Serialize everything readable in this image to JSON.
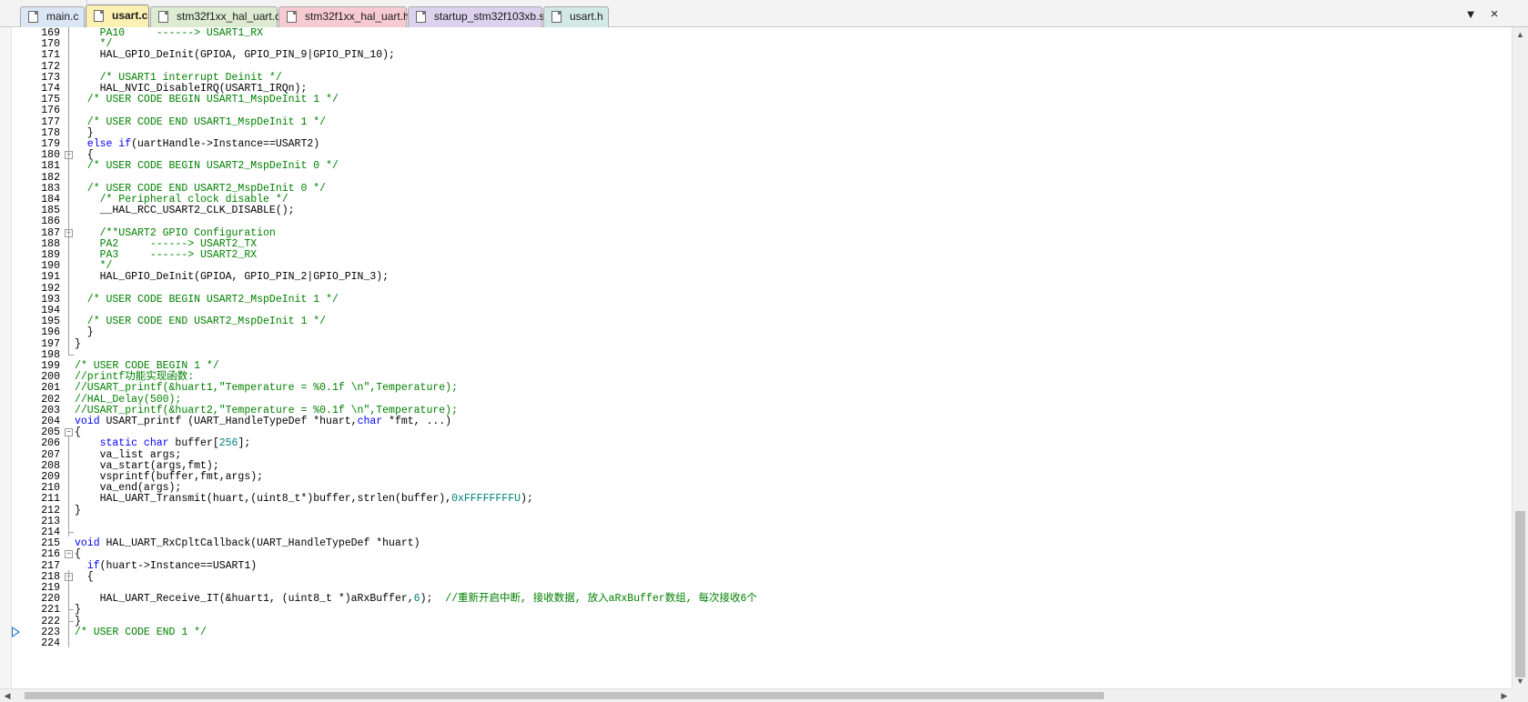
{
  "tabs": [
    {
      "label": "main.c",
      "color": "#dbe6f5",
      "active": false
    },
    {
      "label": "usart.c",
      "color": "#fdf0b3",
      "active": true
    },
    {
      "label": "stm32f1xx_hal_uart.c",
      "color": "#dcebd2",
      "active": false
    },
    {
      "label": "stm32f1xx_hal_uart.h",
      "color": "#f8cbd2",
      "active": false
    },
    {
      "label": "startup_stm32f103xb.s",
      "color": "#dcd2ee",
      "active": false
    },
    {
      "label": "usart.h",
      "color": "#d3e9e5",
      "active": false
    }
  ],
  "tab_controls": {
    "dropdown_icon": "chevron-down-icon",
    "close_icon": "close-icon",
    "dropdown_glyph": "▼",
    "close_glyph": "×"
  },
  "editor": {
    "colors": {
      "comment": "#008000",
      "keyword": "#0000ff",
      "number": "#008080",
      "text": "#000000"
    },
    "current_line": "223",
    "lines": [
      {
        "n": "169",
        "fold": "",
        "segs": [
          [
            "c",
            "    PA10     ------> USART1_RX"
          ]
        ]
      },
      {
        "n": "170",
        "fold": "",
        "segs": [
          [
            "c",
            "    */"
          ]
        ]
      },
      {
        "n": "171",
        "fold": "",
        "segs": [
          [
            "p",
            "    HAL_GPIO_DeInit(GPIOA, GPIO_PIN_9|GPIO_PIN_10);"
          ]
        ]
      },
      {
        "n": "172",
        "fold": "",
        "segs": []
      },
      {
        "n": "173",
        "fold": "",
        "segs": [
          [
            "c",
            "    /* USART1 interrupt Deinit */"
          ]
        ]
      },
      {
        "n": "174",
        "fold": "",
        "segs": [
          [
            "p",
            "    HAL_NVIC_DisableIRQ(USART1_IRQn);"
          ]
        ]
      },
      {
        "n": "175",
        "fold": "",
        "segs": [
          [
            "c",
            "  /* USER CODE BEGIN USART1_MspDeInit 1 */"
          ]
        ]
      },
      {
        "n": "176",
        "fold": "",
        "segs": []
      },
      {
        "n": "177",
        "fold": "",
        "segs": [
          [
            "c",
            "  /* USER CODE END USART1_MspDeInit 1 */"
          ]
        ]
      },
      {
        "n": "178",
        "fold": "",
        "segs": [
          [
            "p",
            "  }"
          ]
        ]
      },
      {
        "n": "179",
        "fold": "",
        "segs": [
          [
            "k",
            "  else if"
          ],
          [
            "p",
            "(uartHandle->Instance==USART2)"
          ]
        ]
      },
      {
        "n": "180",
        "fold": "minus",
        "segs": [
          [
            "p",
            "  {"
          ]
        ]
      },
      {
        "n": "181",
        "fold": "",
        "segs": [
          [
            "c",
            "  /* USER CODE BEGIN USART2_MspDeInit 0 */"
          ]
        ]
      },
      {
        "n": "182",
        "fold": "",
        "segs": []
      },
      {
        "n": "183",
        "fold": "",
        "segs": [
          [
            "c",
            "  /* USER CODE END USART2_MspDeInit 0 */"
          ]
        ]
      },
      {
        "n": "184",
        "fold": "",
        "segs": [
          [
            "c",
            "    /* Peripheral clock disable */"
          ]
        ]
      },
      {
        "n": "185",
        "fold": "",
        "segs": [
          [
            "p",
            "    __HAL_RCC_USART2_CLK_DISABLE();"
          ]
        ]
      },
      {
        "n": "186",
        "fold": "",
        "segs": []
      },
      {
        "n": "187",
        "fold": "minus",
        "segs": [
          [
            "c",
            "    /**USART2 GPIO Configuration"
          ]
        ]
      },
      {
        "n": "188",
        "fold": "",
        "segs": [
          [
            "c",
            "    PA2     ------> USART2_TX"
          ]
        ]
      },
      {
        "n": "189",
        "fold": "",
        "segs": [
          [
            "c",
            "    PA3     ------> USART2_RX"
          ]
        ]
      },
      {
        "n": "190",
        "fold": "",
        "segs": [
          [
            "c",
            "    */"
          ]
        ]
      },
      {
        "n": "191",
        "fold": "",
        "segs": [
          [
            "p",
            "    HAL_GPIO_DeInit(GPIOA, GPIO_PIN_2|GPIO_PIN_3);"
          ]
        ]
      },
      {
        "n": "192",
        "fold": "",
        "segs": []
      },
      {
        "n": "193",
        "fold": "",
        "segs": [
          [
            "c",
            "  /* USER CODE BEGIN USART2_MspDeInit 1 */"
          ]
        ]
      },
      {
        "n": "194",
        "fold": "",
        "segs": []
      },
      {
        "n": "195",
        "fold": "",
        "segs": [
          [
            "c",
            "  /* USER CODE END USART2_MspDeInit 1 */"
          ]
        ]
      },
      {
        "n": "196",
        "fold": "",
        "segs": [
          [
            "p",
            "  }"
          ]
        ]
      },
      {
        "n": "197",
        "fold": "",
        "segs": [
          [
            "p",
            "}"
          ]
        ]
      },
      {
        "n": "198",
        "fold": "end",
        "segs": []
      },
      {
        "n": "199",
        "fold": "",
        "segs": [
          [
            "c",
            "/* USER CODE BEGIN 1 */"
          ]
        ]
      },
      {
        "n": "200",
        "fold": "",
        "segs": [
          [
            "c",
            "//printf功能实现函数:"
          ]
        ]
      },
      {
        "n": "201",
        "fold": "",
        "segs": [
          [
            "c",
            "//USART_printf(&huart1,\"Temperature = %0.1f \\n\",Temperature);"
          ]
        ]
      },
      {
        "n": "202",
        "fold": "",
        "segs": [
          [
            "c",
            "//HAL_Delay(500);"
          ]
        ]
      },
      {
        "n": "203",
        "fold": "",
        "segs": [
          [
            "c",
            "//USART_printf(&huart2,\"Temperature = %0.1f \\n\",Temperature);"
          ]
        ]
      },
      {
        "n": "204",
        "fold": "",
        "segs": [
          [
            "k",
            "void"
          ],
          [
            "p",
            " USART_printf (UART_HandleTypeDef *huart,"
          ],
          [
            "k",
            "char"
          ],
          [
            "p",
            " *fmt, ...)"
          ]
        ]
      },
      {
        "n": "205",
        "fold": "minus",
        "segs": [
          [
            "p",
            "{"
          ]
        ]
      },
      {
        "n": "206",
        "fold": "",
        "segs": [
          [
            "k",
            "    static char"
          ],
          [
            "p",
            " buffer["
          ],
          [
            "n",
            "256"
          ],
          [
            "p",
            "];"
          ]
        ]
      },
      {
        "n": "207",
        "fold": "",
        "segs": [
          [
            "p",
            "    va_list args;"
          ]
        ]
      },
      {
        "n": "208",
        "fold": "",
        "segs": [
          [
            "p",
            "    va_start(args,fmt);"
          ]
        ]
      },
      {
        "n": "209",
        "fold": "",
        "segs": [
          [
            "p",
            "    vsprintf(buffer,fmt,args);"
          ]
        ]
      },
      {
        "n": "210",
        "fold": "",
        "segs": [
          [
            "p",
            "    va_end(args);"
          ]
        ]
      },
      {
        "n": "211",
        "fold": "",
        "segs": [
          [
            "p",
            "    HAL_UART_Transmit(huart,(uint8_t*)buffer,strlen(buffer),"
          ],
          [
            "n",
            "0xFFFFFFFFU"
          ],
          [
            "p",
            ");"
          ]
        ]
      },
      {
        "n": "212",
        "fold": "",
        "segs": [
          [
            "p",
            "}"
          ]
        ]
      },
      {
        "n": "213",
        "fold": "",
        "segs": []
      },
      {
        "n": "214",
        "fold": "end",
        "segs": []
      },
      {
        "n": "215",
        "fold": "",
        "segs": [
          [
            "k",
            "void"
          ],
          [
            "p",
            " HAL_UART_RxCpltCallback(UART_HandleTypeDef *huart)"
          ]
        ]
      },
      {
        "n": "216",
        "fold": "minus",
        "segs": [
          [
            "p",
            "{"
          ]
        ]
      },
      {
        "n": "217",
        "fold": "",
        "segs": [
          [
            "k",
            "  if"
          ],
          [
            "p",
            "(huart->Instance==USART1)"
          ]
        ]
      },
      {
        "n": "218",
        "fold": "minus",
        "segs": [
          [
            "p",
            "  {"
          ]
        ]
      },
      {
        "n": "219",
        "fold": "",
        "segs": []
      },
      {
        "n": "220",
        "fold": "",
        "segs": [
          [
            "p",
            "    HAL_UART_Receive_IT(&huart1, (uint8_t *)aRxBuffer,"
          ],
          [
            "n",
            "6"
          ],
          [
            "p",
            ");  "
          ],
          [
            "c",
            "//重新开启中断, 接收数据, 放入aRxBuffer数组, 每次接收6个"
          ]
        ]
      },
      {
        "n": "221",
        "fold": "end",
        "segs": [
          [
            "p",
            "}"
          ]
        ]
      },
      {
        "n": "222",
        "fold": "end",
        "segs": [
          [
            "p",
            "}"
          ]
        ]
      },
      {
        "n": "223",
        "fold": "",
        "segs": [
          [
            "c",
            "/* USER CODE END 1 */"
          ]
        ]
      },
      {
        "n": "224",
        "fold": "",
        "segs": []
      }
    ]
  },
  "scrollbars": {
    "vertical_position": 0.82,
    "horizontal_position": 0.0,
    "up_icon": "arrow-up-icon",
    "down_icon": "arrow-down-icon",
    "left_icon": "arrow-left-icon",
    "right_icon": "arrow-right-icon",
    "up_glyph": "▲",
    "down_glyph": "▼",
    "left_glyph": "◀",
    "right_glyph": "▶"
  }
}
